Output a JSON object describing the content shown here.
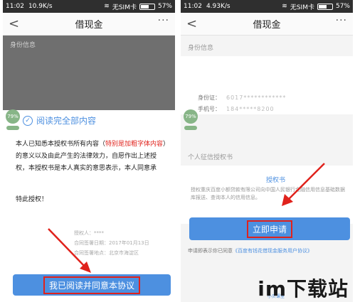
{
  "left": {
    "status": {
      "time": "11:02",
      "speed": "10.9K/s",
      "carrier": "无SIM卡",
      "battery": "57%"
    },
    "nav": {
      "title": "借现金",
      "back": "<",
      "more": "···"
    },
    "section_identity": "身份信息",
    "float_badge": "79%",
    "modal": {
      "title": "阅读完全部内容",
      "body_a": "本人已知悉本授权书所有内容（",
      "body_red": "特别是加粗字体内容",
      "body_b": "）的意义以及由此产生的法律效力，自愿作出上述授权，本授权书是本人真实的意思表示，本人同意承",
      "tail": "特此授权！",
      "stamp_lines": [
        "授权人：****",
        "合同签署日期：2017年01月13日",
        "合同签署地点：北京市海淀区"
      ],
      "button": "我已阅读并同意本协议"
    }
  },
  "right": {
    "status": {
      "time": "11:02",
      "speed": "4.93K/s",
      "carrier": "无SIM卡",
      "battery": "57%"
    },
    "nav": {
      "title": "借现金",
      "back": "<",
      "more": "···"
    },
    "section_identity": "身份信息",
    "float_badge": "79%",
    "rows": [
      {
        "label": "身份证：",
        "value": "6017************"
      },
      {
        "label": "手机号：",
        "value": "184*****8200"
      }
    ],
    "section_credit": "个人征信授权书",
    "auth_link": "授权书",
    "auth_text": "授权重庆百度小额贷款有限公司向中国人民银行金融信用信息基础数据库报送、查询本人的信用信息。",
    "button": "立即申请",
    "agree_prefix": "申请即表示你已同意",
    "agree_link": "《百度有钱花借现金服务用户协议》"
  },
  "watermark": {
    "text": "im下载站",
    "sub": "小贝课堂"
  },
  "colors": {
    "accent": "#4d90e0",
    "highlight": "#e0221c",
    "overlay": "#6f6f6f"
  }
}
